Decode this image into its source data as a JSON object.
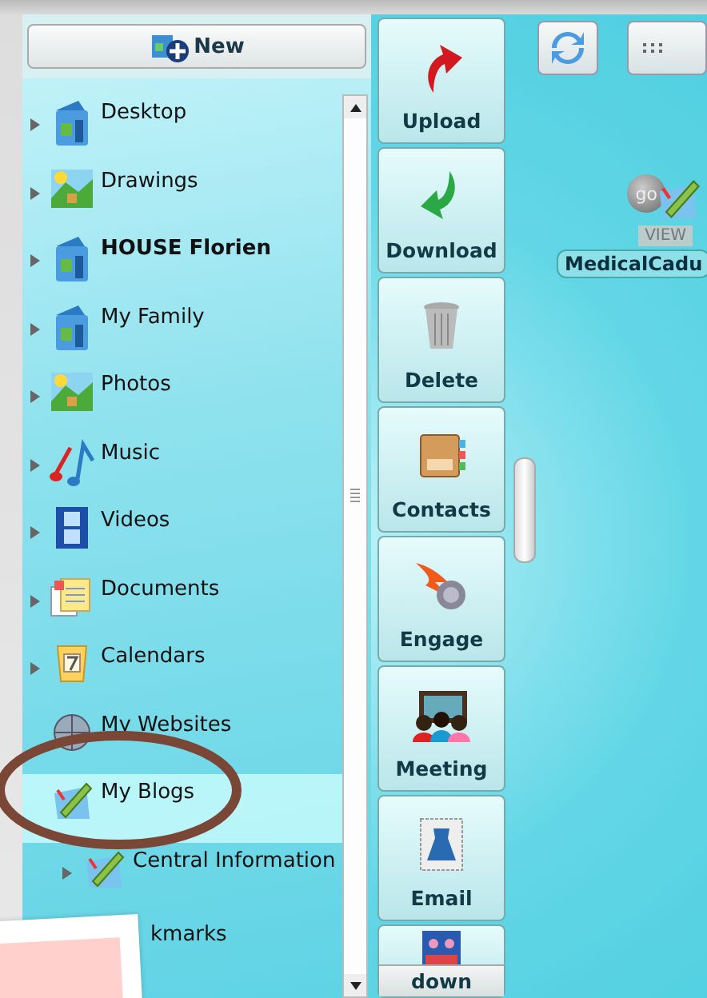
{
  "new_button": {
    "label": "New"
  },
  "folders": [
    {
      "label": "Desktop",
      "kind": "drive",
      "bold": false,
      "expandable": true,
      "selected": false
    },
    {
      "label": "Drawings",
      "kind": "image",
      "bold": false,
      "expandable": true,
      "selected": false
    },
    {
      "label": "HOUSE Florien",
      "kind": "drive",
      "bold": true,
      "expandable": true,
      "selected": false
    },
    {
      "label": "My Family",
      "kind": "drive",
      "bold": false,
      "expandable": true,
      "selected": false
    },
    {
      "label": "Photos",
      "kind": "image",
      "bold": false,
      "expandable": true,
      "selected": false
    },
    {
      "label": "Music",
      "kind": "music",
      "bold": false,
      "expandable": true,
      "selected": false
    },
    {
      "label": "Videos",
      "kind": "video",
      "bold": false,
      "expandable": true,
      "selected": false
    },
    {
      "label": "Documents",
      "kind": "documents",
      "bold": false,
      "expandable": true,
      "selected": false
    },
    {
      "label": "Calendars",
      "kind": "calendar",
      "bold": false,
      "expandable": true,
      "selected": false
    },
    {
      "label": "My Websites",
      "kind": "web",
      "bold": false,
      "expandable": false,
      "selected": false
    },
    {
      "label": "My Blogs",
      "kind": "blog",
      "bold": false,
      "expandable": false,
      "selected": true,
      "children": [
        {
          "label": "Central Information",
          "kind": "blog",
          "bold": false,
          "expandable": true,
          "selected": false
        }
      ]
    },
    {
      "label": "kmarks",
      "kind": "none",
      "bold": false,
      "selected": false
    }
  ],
  "actions": [
    {
      "label": "Upload",
      "kind": "upload"
    },
    {
      "label": "Download",
      "kind": "download"
    },
    {
      "label": "Delete",
      "kind": "trash"
    },
    {
      "label": "Contacts",
      "kind": "book"
    },
    {
      "label": "Engage",
      "kind": "fire"
    },
    {
      "label": "Meeting",
      "kind": "people"
    },
    {
      "label": "Email",
      "kind": "stamp"
    },
    {
      "label": "down",
      "kind": "photo"
    }
  ],
  "file": {
    "badge": "go",
    "view_label": "VIEW",
    "name": "MedicalCadu"
  }
}
